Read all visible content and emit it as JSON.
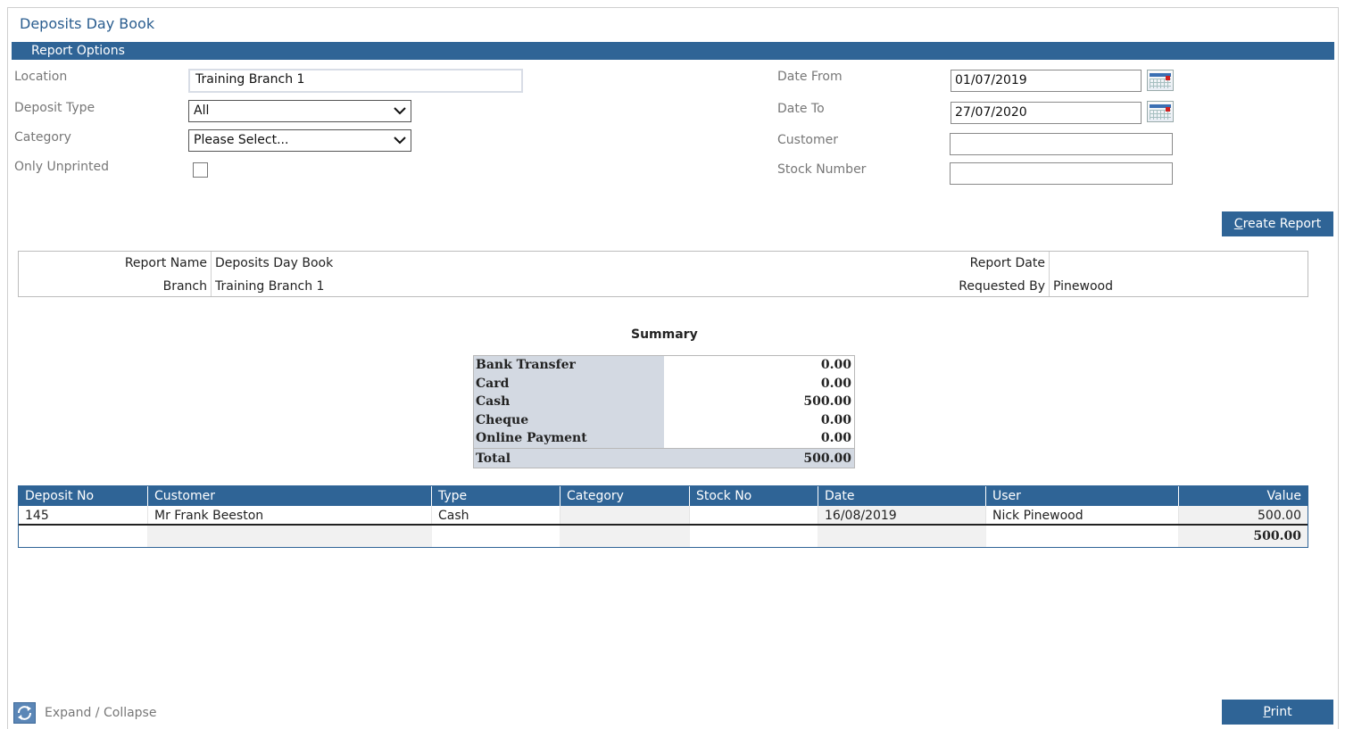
{
  "page_title": "Deposits Day Book",
  "report_options_label": "Report Options",
  "form": {
    "location_label": "Location",
    "location_value": "Training Branch 1",
    "deposit_type_label": "Deposit Type",
    "deposit_type_value": "All",
    "category_label": "Category",
    "category_value": "Please Select...",
    "only_unprinted_label": "Only Unprinted",
    "date_from_label": "Date From",
    "date_from_value": "01/07/2019",
    "date_to_label": "Date To",
    "date_to_value": "27/07/2020",
    "customer_label": "Customer",
    "customer_value": "",
    "stock_number_label": "Stock Number",
    "stock_number_value": ""
  },
  "create_report": {
    "first": "C",
    "rest": "reate Report"
  },
  "report_info": {
    "report_name_label": "Report Name",
    "report_name_value": "Deposits Day Book",
    "branch_label": "Branch",
    "branch_value": "Training Branch 1",
    "report_date_label": "Report Date",
    "report_date_value": "",
    "requested_by_label": "Requested By",
    "requested_by_value": "Pinewood"
  },
  "summary": {
    "title": "Summary",
    "rows": [
      {
        "label": "Bank Transfer",
        "value": "0.00"
      },
      {
        "label": "Card",
        "value": "0.00"
      },
      {
        "label": "Cash",
        "value": "500.00"
      },
      {
        "label": "Cheque",
        "value": "0.00"
      },
      {
        "label": "Online Payment",
        "value": "0.00"
      }
    ],
    "total_label": "Total",
    "total_value": "500.00"
  },
  "table": {
    "headers": [
      "Deposit No",
      "Customer",
      "Type",
      "Category",
      "Stock No",
      "Date",
      "User",
      "Value"
    ],
    "rows": [
      [
        "145",
        "Mr Frank Beeston",
        "Cash",
        "",
        "",
        "16/08/2019",
        "Nick Pinewood",
        "500.00"
      ]
    ],
    "total_value": "500.00"
  },
  "expand_collapse_label": "Expand / Collapse",
  "print": {
    "first": "P",
    "rest": "rint"
  },
  "colors": {
    "accent": "#2f6496",
    "summary_shade": "#d3d9e2"
  }
}
